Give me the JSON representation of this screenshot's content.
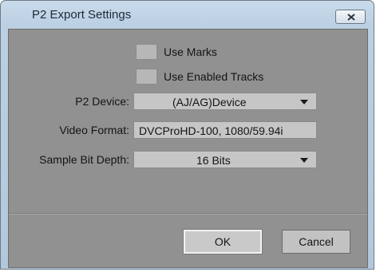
{
  "window": {
    "title": "P2 Export Settings",
    "close_icon": "close-x-icon"
  },
  "options": {
    "use_marks": {
      "label": "Use Marks",
      "checked": false
    },
    "use_enabled_tracks": {
      "label": "Use Enabled Tracks",
      "checked": false
    }
  },
  "settings": {
    "p2_device": {
      "label": "P2 Device:",
      "value": "(AJ/AG)Device"
    },
    "video_format": {
      "label": "Video Format:",
      "value": "DVCProHD-100, 1080/59.94i"
    },
    "bit_depth": {
      "label": "Sample Bit Depth:",
      "value": "16 Bits"
    }
  },
  "buttons": {
    "ok": "OK",
    "cancel": "Cancel"
  }
}
